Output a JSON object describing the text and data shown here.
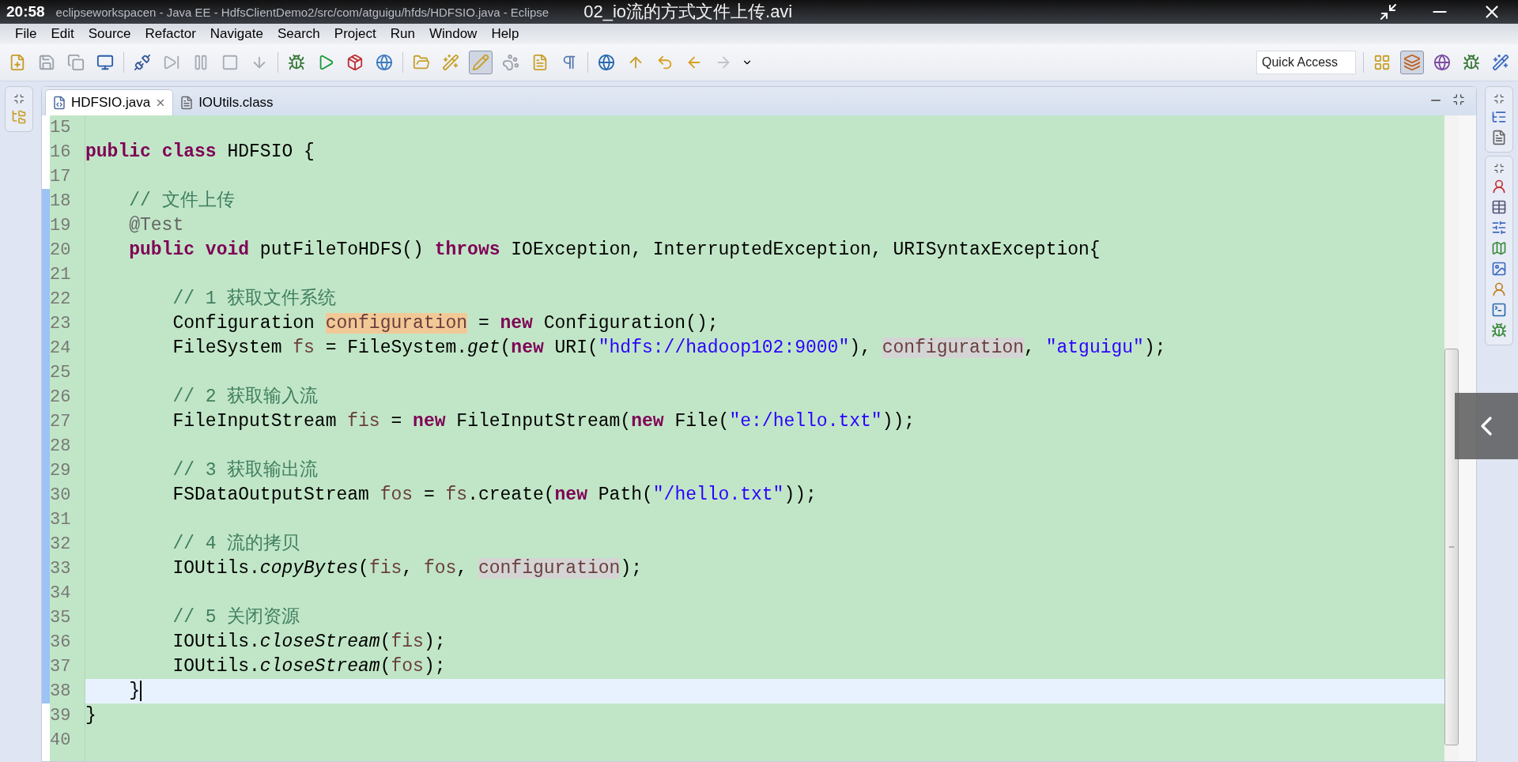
{
  "player": {
    "time": "20:58",
    "video_title": "02_io流的方式文件上传.avi"
  },
  "window": {
    "title": "eclipseworkspacen - Java EE - HdfsClientDemo2/src/com/atguigu/hfds/HDFSIO.java - Eclipse"
  },
  "menu": [
    "File",
    "Edit",
    "Source",
    "Refactor",
    "Navigate",
    "Search",
    "Project",
    "Run",
    "Window",
    "Help"
  ],
  "quick_access": {
    "placeholder": "Quick Access"
  },
  "tabs": [
    {
      "label": "HDFSIO.java",
      "kind": "java",
      "selected": true
    },
    {
      "label": "IOUtils.class",
      "kind": "class",
      "selected": false
    }
  ],
  "lines": [
    {
      "number": "15",
      "current": false,
      "changed": false
    },
    {
      "number": "16",
      "current": false,
      "changed": false,
      "tokens": [
        {
          "kind": "keyword",
          "text": "public"
        },
        {
          "kind": "keyword",
          "text": " class"
        },
        {
          "kind": "text",
          "text": " HDFSIO {"
        }
      ]
    },
    {
      "number": "17",
      "current": false,
      "changed": false
    },
    {
      "number": "18",
      "current": false,
      "changed": true,
      "tokens": [
        {
          "kind": "comment",
          "text": "    // 文件上传"
        }
      ]
    },
    {
      "number": "19",
      "current": false,
      "changed": true,
      "tokens": [
        {
          "kind": "annotation",
          "text": "    @Test"
        }
      ]
    },
    {
      "number": "20",
      "current": false,
      "changed": true,
      "tokens": [
        {
          "kind": "keyword",
          "text": "    public"
        },
        {
          "kind": "keyword",
          "text": " void"
        },
        {
          "kind": "text",
          "text": " putFileToHDFS() "
        },
        {
          "kind": "keyword",
          "text": "throws"
        },
        {
          "kind": "text",
          "text": " IOException, InterruptedException, URISyntaxException{"
        }
      ]
    },
    {
      "number": "21",
      "current": false,
      "changed": true
    },
    {
      "number": "22",
      "current": false,
      "changed": true,
      "tokens": [
        {
          "kind": "comment",
          "text": "        // 1 获取文件系统"
        }
      ]
    },
    {
      "number": "23",
      "current": false,
      "changed": true,
      "tokens": [
        {
          "kind": "text",
          "text": "        Configuration "
        },
        {
          "kind": "declaration",
          "text": "configuration"
        },
        {
          "kind": "text",
          "text": " = "
        },
        {
          "kind": "keyword",
          "text": "new"
        },
        {
          "kind": "text",
          "text": " Configuration();"
        }
      ]
    },
    {
      "number": "24",
      "current": false,
      "changed": true,
      "tokens": [
        {
          "kind": "text",
          "text": "        FileSystem "
        },
        {
          "kind": "variable",
          "text": "fs"
        },
        {
          "kind": "text",
          "text": " = FileSystem."
        },
        {
          "kind": "static",
          "text": "get"
        },
        {
          "kind": "text",
          "text": "("
        },
        {
          "kind": "keyword",
          "text": "new"
        },
        {
          "kind": "text",
          "text": " URI("
        },
        {
          "kind": "string",
          "text": "\"hdfs://hadoop102:9000\""
        },
        {
          "kind": "text",
          "text": "), "
        },
        {
          "kind": "occurrence",
          "text": "configuration"
        },
        {
          "kind": "text",
          "text": ", "
        },
        {
          "kind": "string",
          "text": "\"atguigu\""
        },
        {
          "kind": "text",
          "text": ");"
        }
      ]
    },
    {
      "number": "25",
      "current": false,
      "changed": true
    },
    {
      "number": "26",
      "current": false,
      "changed": true,
      "tokens": [
        {
          "kind": "comment",
          "text": "        // 2 获取输入流"
        }
      ]
    },
    {
      "number": "27",
      "current": false,
      "changed": true,
      "tokens": [
        {
          "kind": "text",
          "text": "        FileInputStream "
        },
        {
          "kind": "variable",
          "text": "fis"
        },
        {
          "kind": "text",
          "text": " = "
        },
        {
          "kind": "keyword",
          "text": "new"
        },
        {
          "kind": "text",
          "text": " FileInputStream("
        },
        {
          "kind": "keyword",
          "text": "new"
        },
        {
          "kind": "text",
          "text": " File("
        },
        {
          "kind": "string",
          "text": "\"e:/hello.txt\""
        },
        {
          "kind": "text",
          "text": "));"
        }
      ]
    },
    {
      "number": "28",
      "current": false,
      "changed": true
    },
    {
      "number": "29",
      "current": false,
      "changed": true,
      "tokens": [
        {
          "kind": "comment",
          "text": "        // 3 获取输出流"
        }
      ]
    },
    {
      "number": "30",
      "current": false,
      "changed": true,
      "tokens": [
        {
          "kind": "text",
          "text": "        FSDataOutputStream "
        },
        {
          "kind": "variable",
          "text": "fos"
        },
        {
          "kind": "text",
          "text": " = "
        },
        {
          "kind": "variable",
          "text": "fs"
        },
        {
          "kind": "text",
          "text": ".create("
        },
        {
          "kind": "keyword",
          "text": "new"
        },
        {
          "kind": "text",
          "text": " Path("
        },
        {
          "kind": "string",
          "text": "\"/hello.txt\""
        },
        {
          "kind": "text",
          "text": "));"
        }
      ]
    },
    {
      "number": "31",
      "current": false,
      "changed": true
    },
    {
      "number": "32",
      "current": false,
      "changed": true,
      "tokens": [
        {
          "kind": "comment",
          "text": "        // 4 流的拷贝"
        }
      ]
    },
    {
      "number": "33",
      "current": false,
      "changed": true,
      "tokens": [
        {
          "kind": "text",
          "text": "        IOUtils."
        },
        {
          "kind": "static",
          "text": "copyBytes"
        },
        {
          "kind": "text",
          "text": "("
        },
        {
          "kind": "variable",
          "text": "fis"
        },
        {
          "kind": "text",
          "text": ", "
        },
        {
          "kind": "variable",
          "text": "fos"
        },
        {
          "kind": "text",
          "text": ", "
        },
        {
          "kind": "occurrence",
          "text": "configuration"
        },
        {
          "kind": "text",
          "text": ");"
        }
      ]
    },
    {
      "number": "34",
      "current": false,
      "changed": true
    },
    {
      "number": "35",
      "current": false,
      "changed": true,
      "tokens": [
        {
          "kind": "comment",
          "text": "        // 5 关闭资源"
        }
      ]
    },
    {
      "number": "36",
      "current": false,
      "changed": true,
      "tokens": [
        {
          "kind": "text",
          "text": "        IOUtils."
        },
        {
          "kind": "static",
          "text": "closeStream"
        },
        {
          "kind": "text",
          "text": "("
        },
        {
          "kind": "variable",
          "text": "fis"
        },
        {
          "kind": "text",
          "text": ");"
        }
      ]
    },
    {
      "number": "37",
      "current": false,
      "changed": true,
      "tokens": [
        {
          "kind": "text",
          "text": "        IOUtils."
        },
        {
          "kind": "static",
          "text": "closeStream"
        },
        {
          "kind": "text",
          "text": "("
        },
        {
          "kind": "variable",
          "text": "fos"
        },
        {
          "kind": "text",
          "text": ");"
        }
      ]
    },
    {
      "number": "38",
      "current": true,
      "changed": true,
      "tokens": [
        {
          "kind": "text",
          "text": "    }"
        }
      ]
    },
    {
      "number": "39",
      "current": false,
      "changed": false,
      "tokens": [
        {
          "kind": "text",
          "text": "}"
        }
      ]
    },
    {
      "number": "40",
      "current": false,
      "changed": false
    }
  ]
}
